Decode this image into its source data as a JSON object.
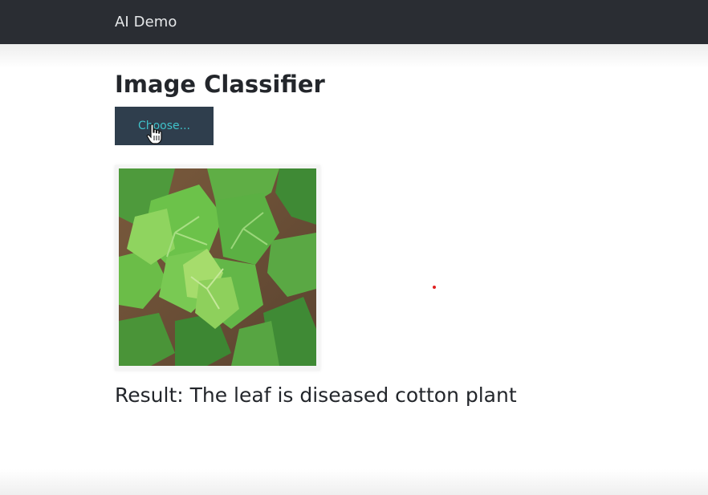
{
  "navbar": {
    "brand": "AI Demo",
    "background": "#2a2d33"
  },
  "main": {
    "title": "Image Classifier",
    "upload_button_label": "Choose...",
    "upload_button_color": "#2f3e4d",
    "upload_button_text_color": "#3fc1c9",
    "preview_image": "cotton-leaf-plant",
    "result_text": "Result: The leaf is diseased cotton plant"
  },
  "overlay": {
    "cursor_icon": "hand-pointer-icon",
    "marker_color": "#e02020"
  }
}
